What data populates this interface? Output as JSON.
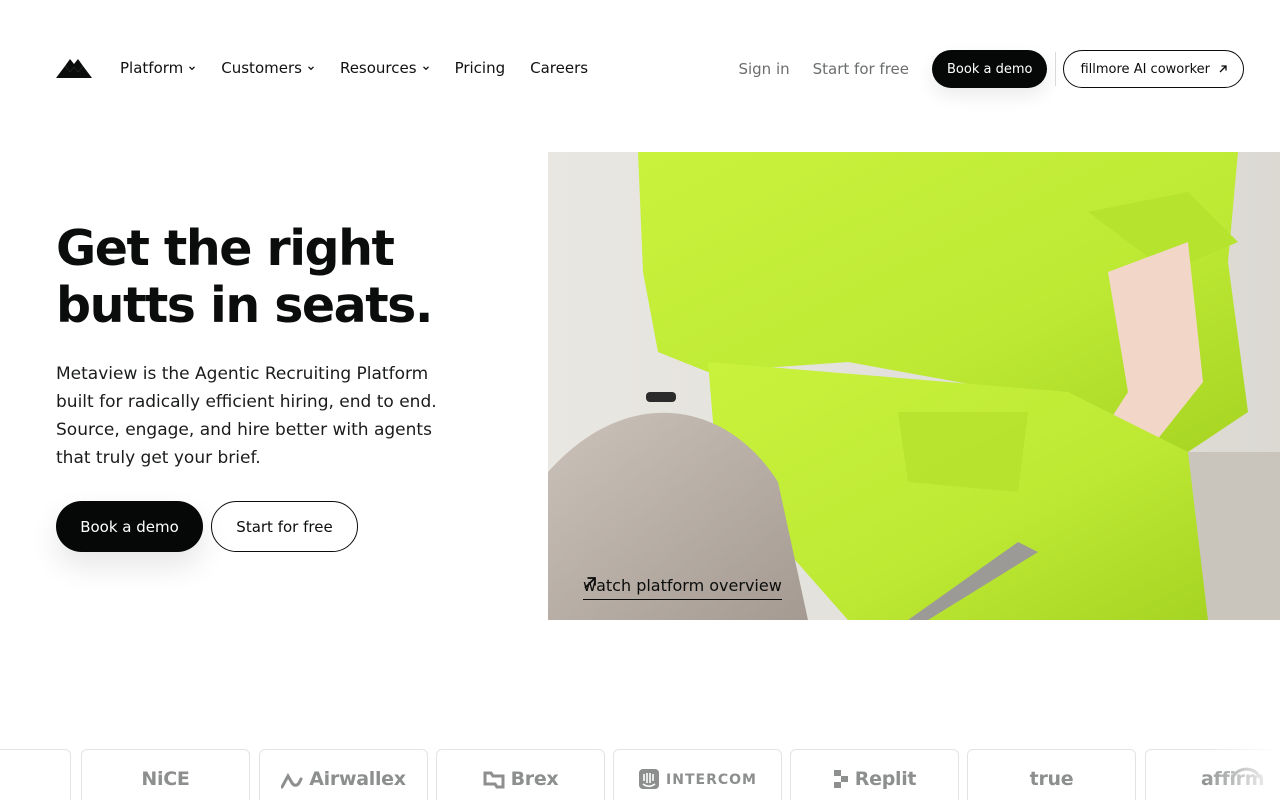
{
  "nav": {
    "logo_icon": "metaview-logo-icon",
    "links": [
      {
        "label": "Platform",
        "has_dropdown": true
      },
      {
        "label": "Customers",
        "has_dropdown": true
      },
      {
        "label": "Resources",
        "has_dropdown": true
      },
      {
        "label": "Pricing",
        "has_dropdown": false
      },
      {
        "label": "Careers",
        "has_dropdown": false
      }
    ],
    "sign_in": "Sign in",
    "start_free": "Start for free",
    "book_demo": "Book a demo",
    "ai_coworker": "fillmore AI coworker"
  },
  "hero": {
    "title_line1": "Get the right",
    "title_line2": "butts in seats.",
    "subtitle": "Metaview is the Agentic Recruiting Platform built for radically efficient hiring, end to end. Source, engage, and hire better with agents that truly get your brief.",
    "cta_primary": "Book a demo",
    "cta_secondary": "Start for free",
    "watch_link": "watch platform overview",
    "image_accent_color": "#c4f03a"
  },
  "customer_logos": [
    {
      "name": "",
      "icon": "partial-logo"
    },
    {
      "name": "NiCE",
      "icon": ""
    },
    {
      "name": "Airwallex",
      "icon": "airwallex-icon"
    },
    {
      "name": "Brex",
      "icon": "brex-icon"
    },
    {
      "name": "INTERCOM",
      "icon": "intercom-icon"
    },
    {
      "name": "Replit",
      "icon": "replit-icon"
    },
    {
      "name": "true",
      "icon": ""
    },
    {
      "name": "affirm",
      "icon": "affirm-arc-icon"
    }
  ],
  "colors": {
    "primary_dark": "#050807",
    "muted_text": "#6b6e6d",
    "logo_gray": "#8c8f8e",
    "hero_green": "#c4f03a"
  }
}
